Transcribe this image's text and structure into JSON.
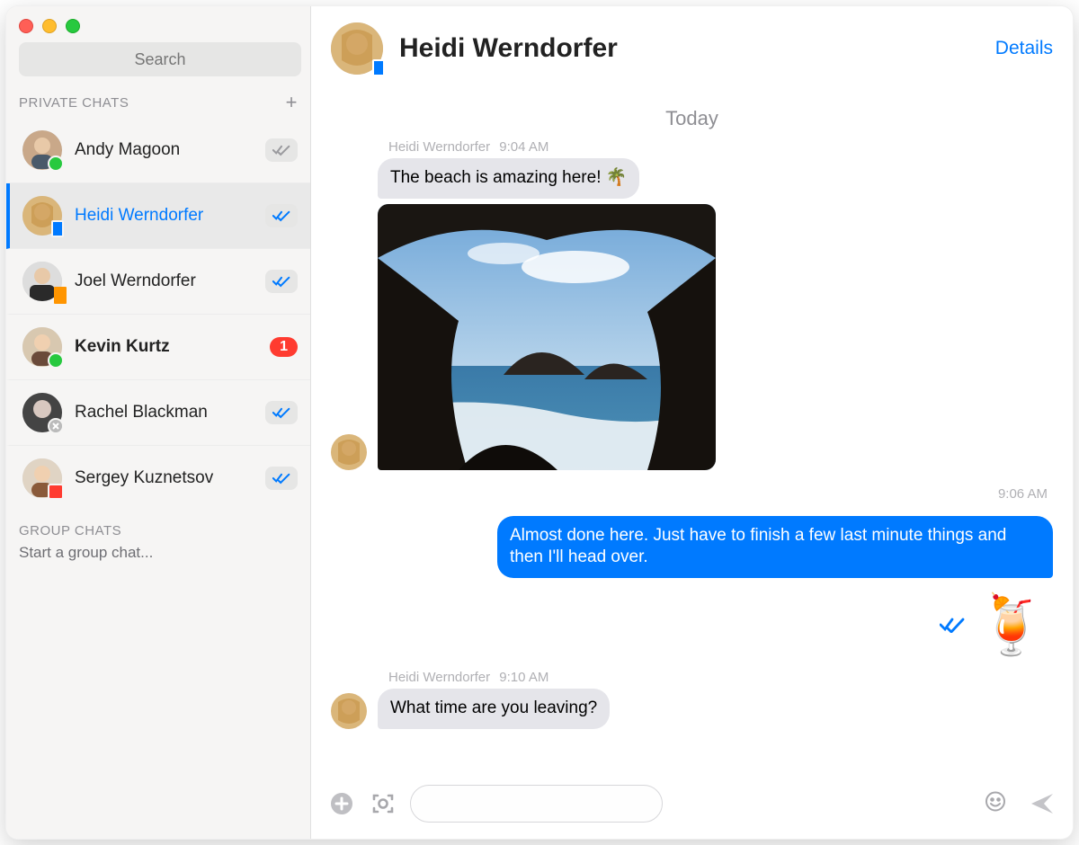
{
  "sidebar": {
    "search_placeholder": "Search",
    "private_header": "PRIVATE CHATS",
    "group_header": "GROUP CHATS",
    "group_start": "Start a group chat...",
    "items": [
      {
        "name": "Andy Magoon",
        "presence": "green",
        "receipt": "gray",
        "selected": false,
        "unread": 0
      },
      {
        "name": "Heidi Werndorfer",
        "presence": "mobile",
        "receipt": "blue",
        "selected": true,
        "unread": 0
      },
      {
        "name": "Joel Werndorfer",
        "presence": "orange",
        "receipt": "blue",
        "selected": false,
        "unread": 0
      },
      {
        "name": "Kevin Kurtz",
        "presence": "green",
        "receipt": "none",
        "selected": false,
        "unread": 1
      },
      {
        "name": "Rachel Blackman",
        "presence": "gray",
        "receipt": "blue",
        "selected": false,
        "unread": 0
      },
      {
        "name": "Sergey Kuznetsov",
        "presence": "red",
        "receipt": "blue",
        "selected": false,
        "unread": 0
      }
    ]
  },
  "header": {
    "title": "Heidi Werndorfer",
    "details": "Details"
  },
  "conversation": {
    "day_label": "Today",
    "messages": [
      {
        "dir": "in",
        "sender": "Heidi Werndorfer",
        "time": "9:04 AM",
        "text": "The beach is amazing here!  🌴",
        "has_photo": true
      },
      {
        "dir": "out",
        "time": "9:06 AM",
        "text": "Almost done here. Just have to finish a few last minute things and then I'll head over.",
        "emoji": "🍹"
      },
      {
        "dir": "in",
        "sender": "Heidi Werndorfer",
        "time": "9:10 AM",
        "text": "What time are you leaving?"
      }
    ]
  },
  "composer": {
    "placeholder": ""
  }
}
